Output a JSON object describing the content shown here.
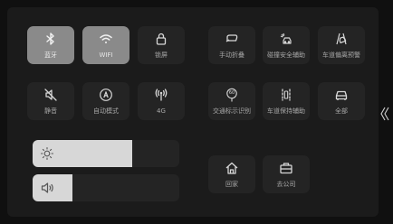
{
  "tiles": {
    "bluetooth": {
      "label": "蓝牙",
      "icon": "bluetooth-icon"
    },
    "wifi": {
      "label": "WIFI",
      "icon": "wifi-icon"
    },
    "lock": {
      "label": "锁屏",
      "icon": "lock-icon"
    },
    "fold_mirror": {
      "label": "手动折叠",
      "icon": "mirror-fold-icon"
    },
    "collision": {
      "label": "碰撞安全辅助",
      "icon": "collision-car-icon"
    },
    "lane_departure": {
      "label": "车道偏离预警",
      "icon": "lane-departure-icon"
    },
    "mute": {
      "label": "静音",
      "icon": "mute-icon"
    },
    "auto_mode": {
      "label": "自动模式",
      "icon": "auto-mode-icon"
    },
    "signal_4g": {
      "label": "4G",
      "icon": "signal-antenna-icon"
    },
    "traffic_sign": {
      "label": "交通标示识别",
      "icon": "speed-limit-sign-icon"
    },
    "sign_value": "60",
    "lane_keep": {
      "label": "车道保持辅助",
      "icon": "lane-keep-icon"
    },
    "all": {
      "label": "全部",
      "icon": "car-icon"
    },
    "home": {
      "label": "回家",
      "icon": "home-icon"
    },
    "company": {
      "label": "去公司",
      "icon": "briefcase-icon"
    }
  },
  "sliders": {
    "brightness": {
      "icon": "brightness-icon",
      "level": 0.68
    },
    "volume": {
      "icon": "volume-icon",
      "level": 0.27
    }
  },
  "colors": {
    "active_tile": "#8a8a8a",
    "tile": "#242424",
    "background": "#1b1b1b",
    "slider_fill": "#d7d7d7"
  },
  "side": {
    "icon": "double-chevron-left-icon"
  }
}
